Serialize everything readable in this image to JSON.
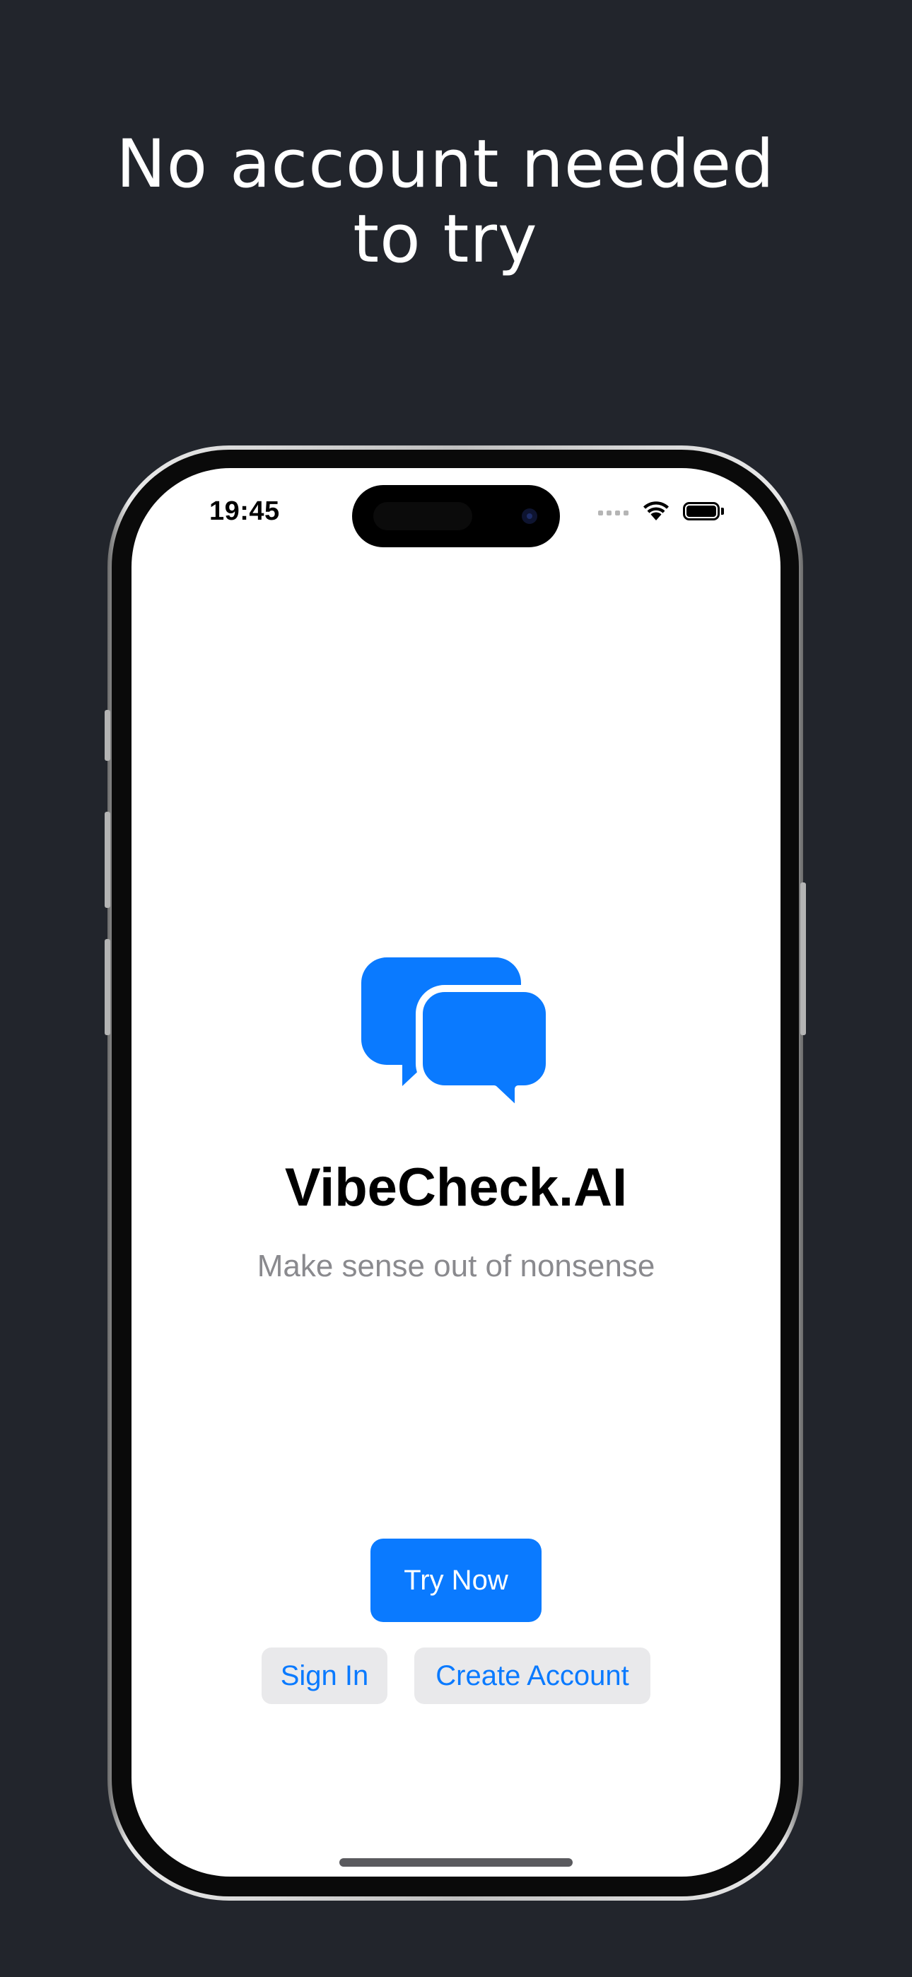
{
  "headline": {
    "line1": "No account needed",
    "line2": "to try"
  },
  "status_bar": {
    "time": "19:45",
    "wifi_icon": "wifi-icon",
    "battery_icon": "battery-icon",
    "battery_level": 1.0
  },
  "app": {
    "logo_icon": "chat-bubbles-icon",
    "title": "VibeCheck.AI",
    "tagline": "Make sense out of nonsense",
    "accent_color": "#0A7AFF"
  },
  "actions": {
    "try_now": "Try Now",
    "sign_in": "Sign In",
    "create_account": "Create Account"
  },
  "colors": {
    "background": "#22252C",
    "screen": "#FFFFFF",
    "secondary_button_bg": "#E9E9EB",
    "tagline_gray": "#8A8A8E"
  }
}
